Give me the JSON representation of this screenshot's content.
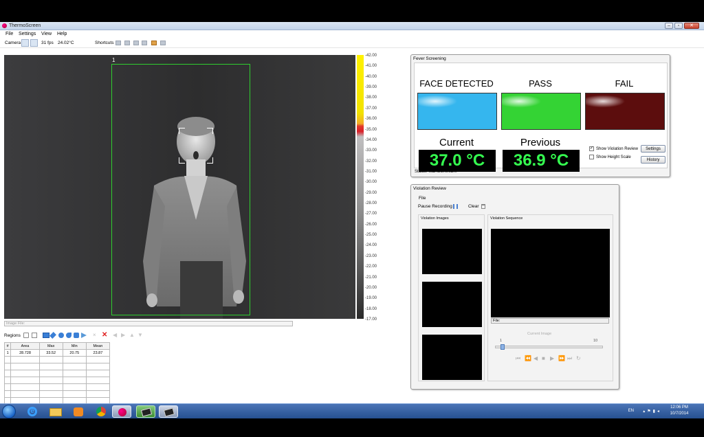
{
  "window": {
    "title": "ThermoScreen",
    "controls": {
      "minimize": "–",
      "maximize": "▫",
      "close": "✕"
    }
  },
  "menu": [
    "File",
    "Settings",
    "View",
    "Help"
  ],
  "toolbar": {
    "camera_label": "Camera",
    "fps": "31 fps",
    "temperature": "24.02°C",
    "shortcuts_label": "Shortcuts"
  },
  "thermal_view": {
    "roi_label": "1",
    "scale_labels": [
      "42.00",
      "41.00",
      "40.00",
      "39.00",
      "38.00",
      "37.00",
      "36.00",
      "35.00",
      "34.00",
      "33.00",
      "32.00",
      "31.00",
      "30.00",
      "29.00",
      "28.00",
      "27.00",
      "26.00",
      "25.00",
      "24.00",
      "23.00",
      "22.00",
      "21.00",
      "20.00",
      "19.00",
      "18.00",
      "17.00"
    ]
  },
  "image_file_label": "Image File:",
  "regions": {
    "label": "Regions",
    "columns": [
      "#",
      "Area",
      "Max",
      "Min",
      "Mean"
    ],
    "rows": [
      [
        "1",
        "28.728",
        "33.52",
        "20.75",
        "23.87"
      ]
    ],
    "empty_rows": 7
  },
  "fever_screening": {
    "title": "Fever Screening",
    "headers": {
      "face": "FACE DETECTED",
      "pass": "PASS",
      "fail": "FAIL"
    },
    "lamp_colors": {
      "face": "#35b6ee",
      "pass": "#34d334",
      "fail": "#5c0d0d"
    },
    "current_label": "Current",
    "previous_label": "Previous",
    "current_temp": "37.0 °C",
    "previous_temp": "36.9 °C",
    "temp_color": "#35ff50",
    "show_violation_review": "Show Violation Review",
    "show_violation_review_checked": true,
    "show_height_scale": "Show Height Scale",
    "show_height_scale_checked": false,
    "settings_button": "Settings",
    "history_button": "History",
    "status": "Status:  MEASURING..."
  },
  "violation_review": {
    "title": "Violation Review",
    "menu_file": "File",
    "pause_recording": "Pause Recording",
    "clear": "Clear",
    "images_label": "Violation Images",
    "sequence_label": "Violation Sequence",
    "sequence_file": "File:",
    "current_image_label": "Current Image",
    "slider_min": "1",
    "slider_max": "10"
  },
  "taskbar": {
    "language": "EN",
    "time": "12:06 PM",
    "date": "10/7/2014"
  }
}
